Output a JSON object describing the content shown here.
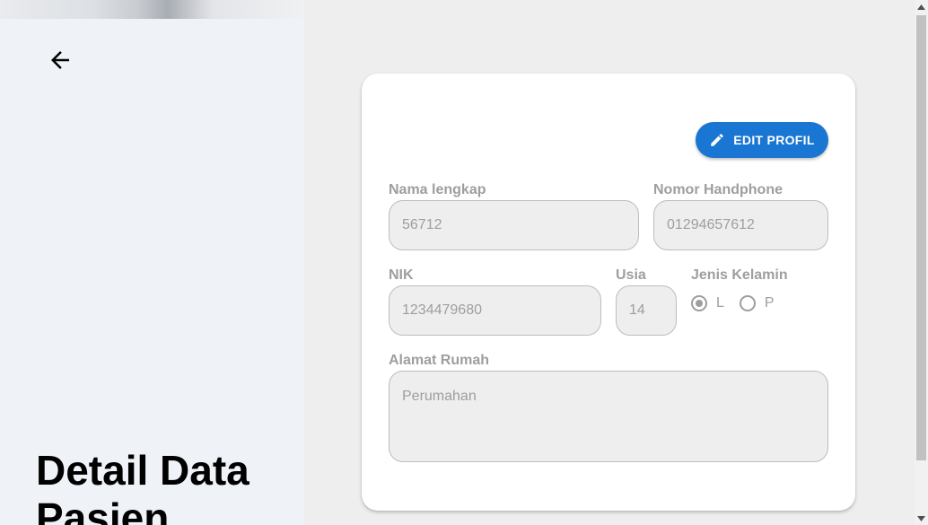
{
  "left": {
    "title": "Detail Data Pasien",
    "back_icon": "arrow-left-icon"
  },
  "toolbar": {
    "edit_label": "EDIT PROFIL",
    "edit_icon": "pencil-icon",
    "accent_color": "#1976d2"
  },
  "form": {
    "nama": {
      "label": "Nama lengkap",
      "value": "56712"
    },
    "phone": {
      "label": "Nomor Handphone",
      "value": "01294657612"
    },
    "nik": {
      "label": "NIK",
      "value": "1234479680"
    },
    "usia": {
      "label": "Usia",
      "value": "14"
    },
    "gender": {
      "label": "Jenis Kelamin",
      "options": [
        {
          "label": "L",
          "selected": true
        },
        {
          "label": "P",
          "selected": false
        }
      ]
    },
    "alamat": {
      "label": "Alamat Rumah",
      "value": "Perumahan"
    }
  }
}
